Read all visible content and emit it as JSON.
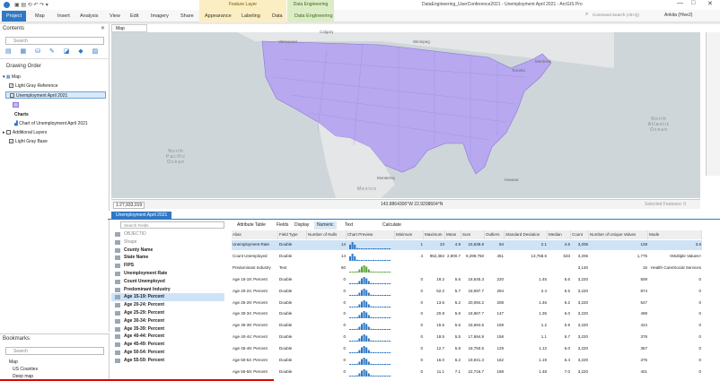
{
  "window": {
    "title": "DataEngineering_UserConference2021 - Unemployment April 2021 - ArcGIS Pro",
    "search": "Command Search (Alt+Q)",
    "user": "Ankita (Hive2)"
  },
  "ribbon": {
    "tabs": [
      "Project",
      "Map",
      "Insert",
      "Analysis",
      "View",
      "Edit",
      "Imagery",
      "Share",
      "Appearance",
      "Labeling",
      "Data",
      "Data Engineering"
    ],
    "context_feature_layer": "Feature Layer",
    "context_data_engineering": "Data Engineering"
  },
  "contents": {
    "title": "Contents",
    "search_placeholder": "Search",
    "drawing_order": "Drawing Order",
    "items": [
      "Map",
      "Light Gray Reference",
      "Unemployment April 2021",
      "Charts",
      "Chart of Unemployment April 2021",
      "Additional Layers",
      "Light Gray Base"
    ]
  },
  "bookmarks": {
    "title": "Bookmarks",
    "search_placeholder": "Search",
    "items": [
      "Map",
      "US Counties",
      "Deep map"
    ]
  },
  "map": {
    "tab": "Map",
    "labels": [
      "Calgary",
      "Vancouver",
      "Seattle",
      "Winnipeg",
      "Montreal",
      "Toronto",
      "North Atlantic Ocean",
      "North Pacific Ocean",
      "Mexico",
      "Monterrey",
      "Havana"
    ],
    "scale": "1:27,933,019",
    "coords": "143.8864306°W 22.9298604°N",
    "selected": "Selected Features: 0"
  },
  "attr": {
    "tab": "Unemployment April 2021",
    "search_placeholder": "Search Fields",
    "toolbar": [
      "Attribute Table",
      "Fields",
      "Display",
      "Numeric",
      "Text",
      "Calculate"
    ],
    "fields": [
      "OBJECTID",
      "Shape",
      "County Name",
      "State Name",
      "FIPS",
      "Unemployment Rate",
      "Count Unemployed",
      "Predominant Industry",
      "Age 15-19: Percent",
      "Age 20-24: Percent",
      "Age 25-29: Percent",
      "Age 30-34: Percent",
      "Age 35-39: Percent",
      "Age 40-44: Percent",
      "Age 45-49: Percent",
      "Age 50-54: Percent",
      "Age 55-59: Percent"
    ],
    "headers": [
      "Alias",
      "Field Type",
      "Number of Nulls",
      "Chart Preview",
      "Minimum",
      "Maximum",
      "Mean",
      "Sum",
      "Outliers",
      "Standard Deviation",
      "Median",
      "Count",
      "Number of Unique Values",
      "Mode"
    ],
    "rows": [
      [
        "Unemployment Rate",
        "Double",
        "14",
        "",
        "1",
        "23",
        "4.9",
        "15,639.9",
        "94",
        "2.1",
        "4.5",
        "3,206",
        "128",
        "3.6"
      ],
      [
        "Count Unemployed",
        "Double",
        "14",
        "",
        "4",
        "962,384",
        "2,900.7",
        "9,299,750",
        "451",
        "13,768.6",
        "533",
        "3,206",
        "1,775",
        "<Multiple Values>"
      ],
      [
        "Predominant Industry",
        "Text",
        "60",
        "",
        "",
        "",
        "",
        "",
        "",
        "",
        "",
        "3,140",
        "15",
        "Health Care/Social Services"
      ],
      [
        "Age 15-19: Percent",
        "Double",
        "0",
        "",
        "0",
        "19.2",
        "5.6",
        "18,645.3",
        "220",
        "1.45",
        "5.6",
        "3,220",
        "509",
        "0"
      ],
      [
        "Age 20-24: Percent",
        "Double",
        "0",
        "",
        "0",
        "52.2",
        "5.7",
        "18,597.7",
        "294",
        "2.4",
        "5.5",
        "3,220",
        "874",
        "0"
      ],
      [
        "Age 25-29: Percent",
        "Double",
        "0",
        "",
        "0",
        "13.6",
        "6.2",
        "20,094.2",
        "208",
        "1.46",
        "6.2",
        "3,220",
        "547",
        "0"
      ],
      [
        "Age 30-34: Percent",
        "Double",
        "0",
        "",
        "0",
        "20.8",
        "5.8",
        "18,967.7",
        "147",
        "1.35",
        "6.0",
        "3,220",
        "498",
        "0"
      ],
      [
        "Age 35-39: Percent",
        "Double",
        "0",
        "",
        "0",
        "15.6",
        "5.6",
        "18,694.5",
        "159",
        "1.2",
        "5.9",
        "3,220",
        "424",
        "0"
      ],
      [
        "Age 40-44: Percent",
        "Double",
        "0",
        "",
        "0",
        "19.5",
        "5.5",
        "17,694.9",
        "158",
        "1.1",
        "5.7",
        "3,220",
        "378",
        "0"
      ],
      [
        "Age 45-49: Percent",
        "Double",
        "0",
        "",
        "0",
        "12.7",
        "5.8",
        "18,750.5",
        "129",
        "1.12",
        "6.0",
        "3,220",
        "357",
        "0"
      ],
      [
        "Age 50-54: Percent",
        "Double",
        "0",
        "",
        "0",
        "16.0",
        "6.2",
        "19,941.3",
        "162",
        "1.19",
        "6.4",
        "3,220",
        "375",
        "0"
      ],
      [
        "Age 55-59: Percent",
        "Double",
        "0",
        "",
        "0",
        "11.1",
        "7.1",
        "22,716.7",
        "188",
        "1.48",
        "7.0",
        "3,220",
        "401",
        "0"
      ]
    ]
  }
}
